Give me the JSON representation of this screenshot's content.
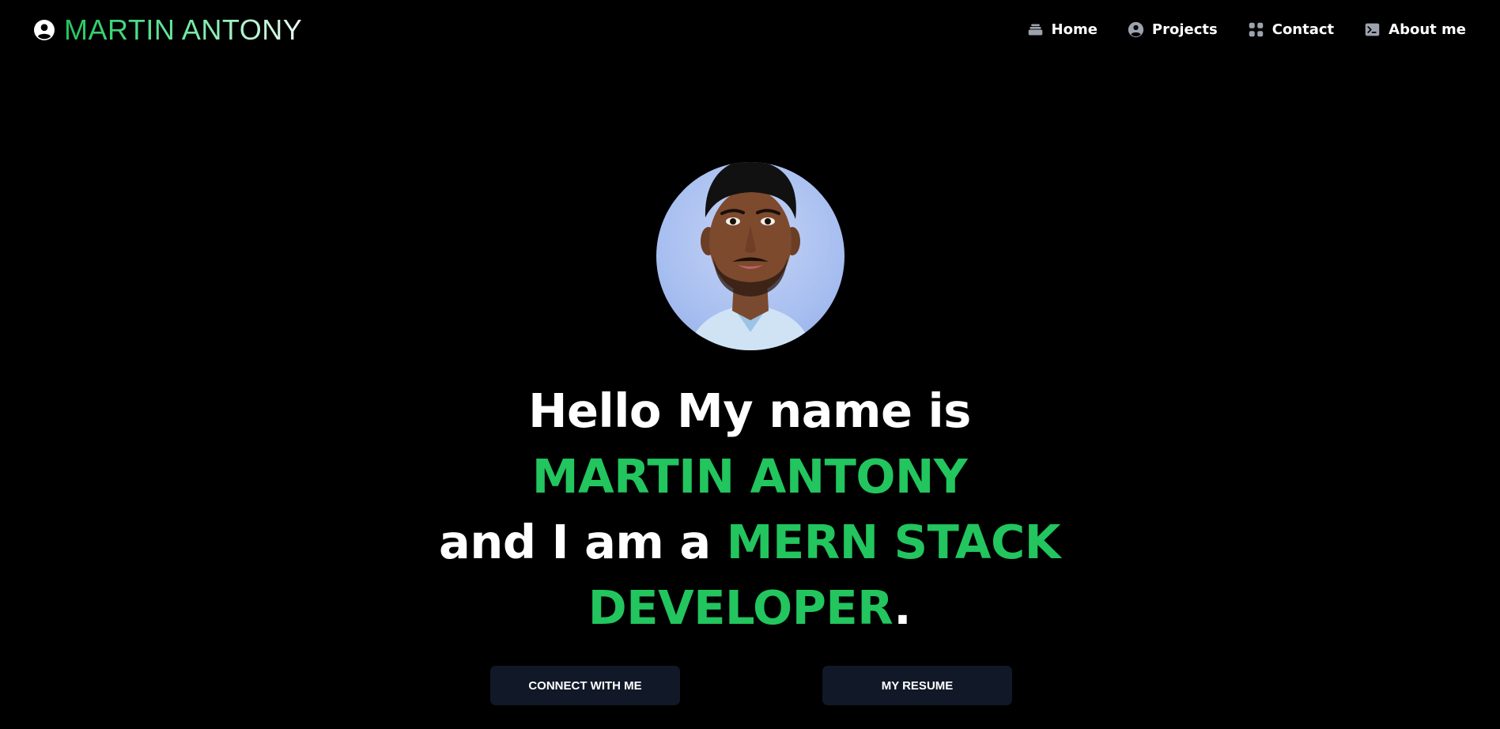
{
  "brand": {
    "name": "MARTIN ANTONY",
    "icon": "user-circle-icon"
  },
  "nav": {
    "items": [
      {
        "label": "Home",
        "icon": "stack-icon"
      },
      {
        "label": "Projects",
        "icon": "user-circle-icon"
      },
      {
        "label": "Contact",
        "icon": "grid-icon"
      },
      {
        "label": "About me",
        "icon": "terminal-icon"
      }
    ]
  },
  "hero": {
    "intro": "Hello My name is ",
    "name": "MARTIN ANTONY",
    "middle": "and I am a ",
    "role": "MERN STACK DEVELOPER",
    "end": "."
  },
  "buttons": {
    "connect": "CONNECT WITH ME",
    "resume": "MY RESUME"
  },
  "colors": {
    "background": "#000000",
    "accent": "#22c55e",
    "button_bg": "#111827",
    "nav_icon": "#9ca3af"
  }
}
